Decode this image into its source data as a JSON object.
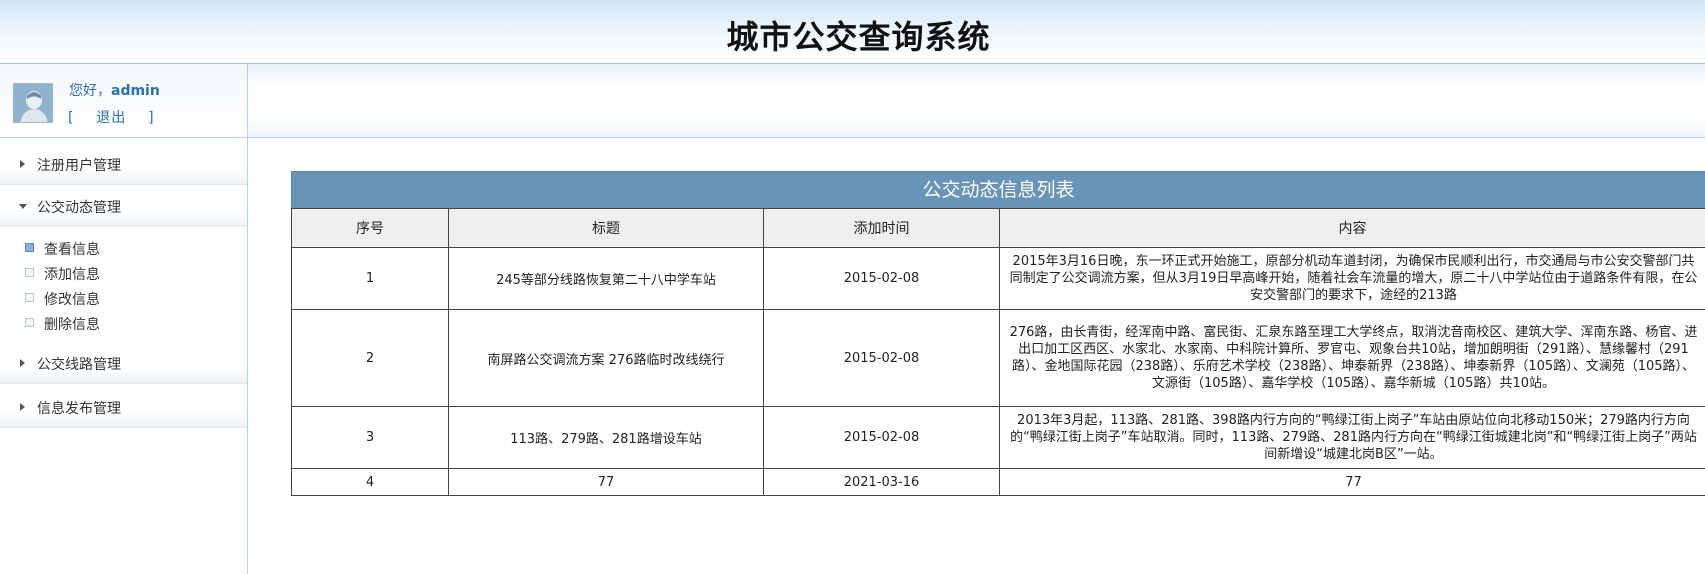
{
  "header": {
    "title": "城市公交查询系统"
  },
  "user": {
    "greeting_prefix": "您好，",
    "username": "admin",
    "logout_label": "[    退出    ]"
  },
  "sidebar": {
    "groups": [
      {
        "label": "注册用户管理",
        "expanded": false
      },
      {
        "label": "公交动态管理",
        "expanded": true,
        "items": [
          {
            "label": "查看信息",
            "active": true
          },
          {
            "label": "添加信息",
            "active": false
          },
          {
            "label": "修改信息",
            "active": false
          },
          {
            "label": "删除信息",
            "active": false
          }
        ]
      },
      {
        "label": "公交线路管理",
        "expanded": false
      },
      {
        "label": "信息发布管理",
        "expanded": false
      }
    ]
  },
  "table": {
    "caption": "公交动态信息列表",
    "columns": [
      "序号",
      "标题",
      "添加时间",
      "内容"
    ],
    "rows": [
      {
        "id": "1",
        "title": "245等部分线路恢复第二十八中学车站",
        "date": "2015-02-08",
        "content": "2015年3月16日晚，东一环正式开始施工，原部分机动车道封闭，为确保市民顺利出行，市交通局与市公安交警部门共同制定了公交调流方案，但从3月19日早高峰开始，随着社会车流量的增大，原二十八中学站位由于道路条件有限，在公安交警部门的要求下，途经的213路"
      },
      {
        "id": "2",
        "title": "南屏路公交调流方案 276路临时改线绕行",
        "date": "2015-02-08",
        "content": "276路，由长青街，经浑南中路、富民街、汇泉东路至理工大学终点，取消沈音南校区、建筑大学、浑南东路、杨官、进出口加工区西区、水家北、水家南、中科院计算所、罗官屯、观象台共10站，增加朗明街（291路）、慧缘馨村（291路）、金地国际花园（238路）、乐府艺术学校（238路）、坤泰新界（238路）、坤泰新界（105路）、文澜苑（105路）、文源街（105路）、嘉华学校（105路）、嘉华新城（105路）共10站。"
      },
      {
        "id": "3",
        "title": "113路、279路、281路增设车站",
        "date": "2015-02-08",
        "content": "2013年3月起，113路、281路、398路内行方向的“鸭绿江街上岗子”车站由原站位向北移动150米；279路内行方向的“鸭绿江街上岗子”车站取消。同时，113路、279路、281路内行方向在“鸭绿江街城建北岗”和“鸭绿江街上岗子”两站间新增设“城建北岗B区”一站。"
      },
      {
        "id": "4",
        "title": "77",
        "date": "2021-03-16",
        "content": "77"
      }
    ]
  }
}
